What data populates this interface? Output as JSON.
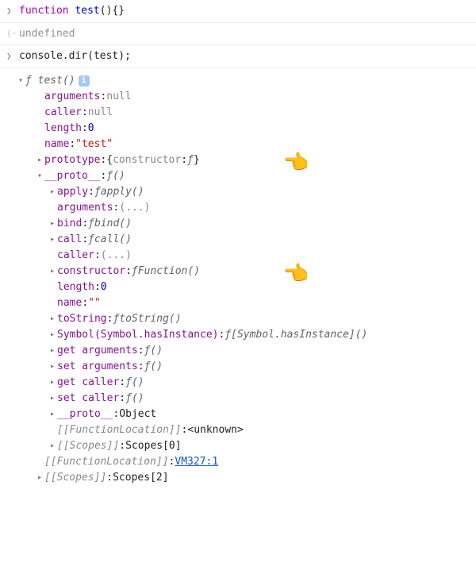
{
  "input1": {
    "kw": "function",
    "name": "test",
    "suffix": "(){}"
  },
  "output1": "undefined",
  "input2": {
    "obj": "console",
    "method": "dir",
    "arg": "test",
    "semi": ";"
  },
  "tree": {
    "header": {
      "f": "ƒ",
      "name": "test()",
      "info": "i"
    },
    "arguments": {
      "key": "arguments",
      "val": "null"
    },
    "caller": {
      "key": "caller",
      "val": "null"
    },
    "length": {
      "key": "length",
      "val": "0"
    },
    "name": {
      "key": "name",
      "val": "\"test\""
    },
    "prototype": {
      "key": "prototype",
      "val_open": "{",
      "ck": "constructor",
      "cv": "ƒ",
      "val_close": "}"
    },
    "proto": {
      "key": "__proto__",
      "f": "ƒ",
      "val": "()",
      "apply": {
        "key": "apply",
        "f": "ƒ",
        "name": "apply()"
      },
      "arguments": {
        "key": "arguments",
        "val": "(...)"
      },
      "bind": {
        "key": "bind",
        "f": "ƒ",
        "name": "bind()"
      },
      "call": {
        "key": "call",
        "f": "ƒ",
        "name": "call()"
      },
      "caller": {
        "key": "caller",
        "val": "(...)"
      },
      "constructor": {
        "key": "constructor",
        "f": "ƒ",
        "name": "Function()"
      },
      "length": {
        "key": "length",
        "val": "0"
      },
      "name": {
        "key": "name",
        "val": "\"\""
      },
      "toString": {
        "key": "toString",
        "f": "ƒ",
        "name": "toString()"
      },
      "symbol": {
        "key": "Symbol(Symbol.hasInstance)",
        "f": "ƒ",
        "name": "[Symbol.hasInstance]()"
      },
      "getArgs": {
        "key": "get arguments",
        "f": "ƒ",
        "name": "()"
      },
      "setArgs": {
        "key": "set arguments",
        "f": "ƒ",
        "name": "()"
      },
      "getCaller": {
        "key": "get caller",
        "f": "ƒ",
        "name": "()"
      },
      "setCaller": {
        "key": "set caller",
        "f": "ƒ",
        "name": "()"
      },
      "proto2": {
        "key": "__proto__",
        "val": "Object"
      },
      "funcLoc": {
        "key": "[[FunctionLocation]]",
        "val": "<unknown>"
      },
      "scopes": {
        "key": "[[Scopes]]",
        "val": "Scopes[0]"
      }
    },
    "funcLoc": {
      "key": "[[FunctionLocation]]",
      "val": "VM327:1"
    },
    "scopes": {
      "key": "[[Scopes]]",
      "val": "Scopes[2]"
    }
  }
}
